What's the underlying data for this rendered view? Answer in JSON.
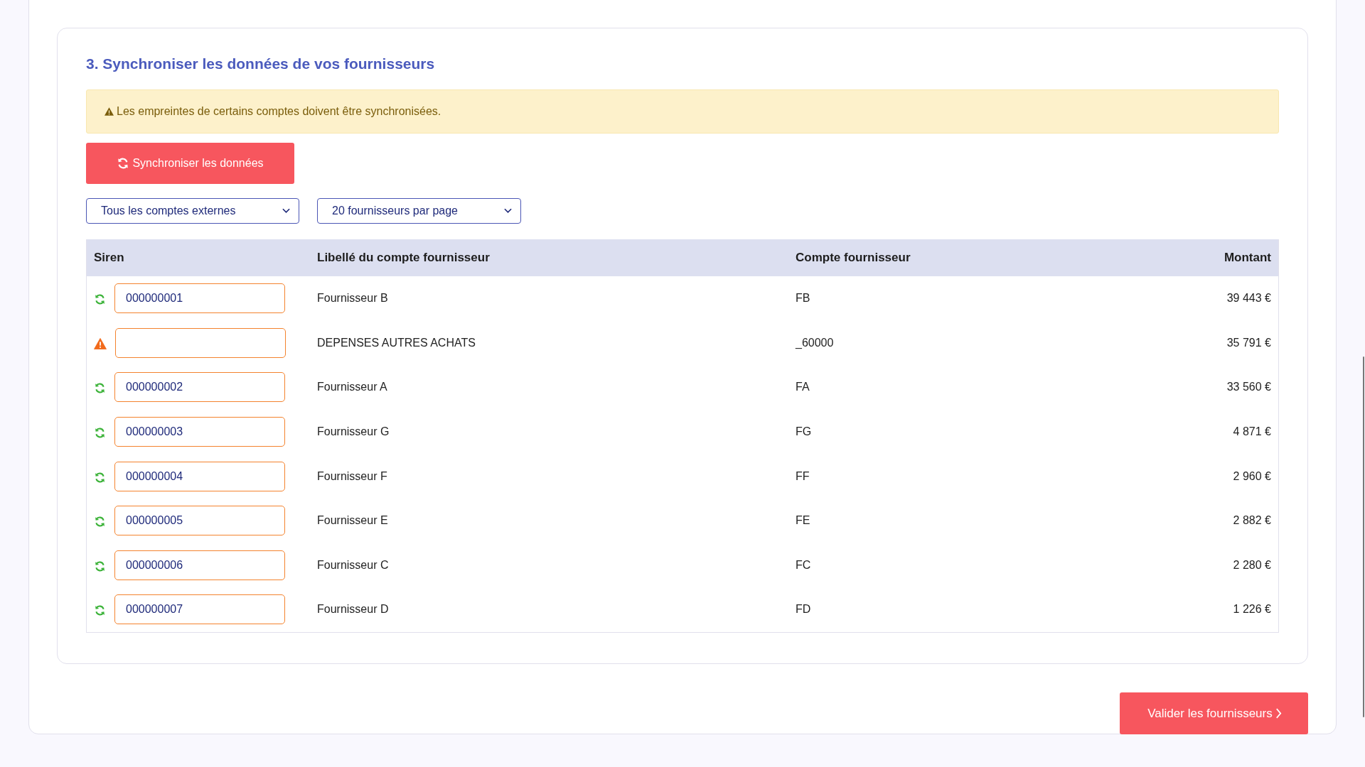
{
  "section": {
    "title": "3. Synchroniser les données de vos fournisseurs"
  },
  "alert": {
    "text": "Les empreintes de certains comptes doivent être synchronisées."
  },
  "sync_button": {
    "label": "Synchroniser les données"
  },
  "filters": [
    {
      "value": "Tous les comptes externes"
    },
    {
      "value": "20 fournisseurs par page"
    }
  ],
  "table": {
    "columns": [
      "Siren",
      "Libellé du compte fournisseur",
      "Compte fournisseur",
      "Montant"
    ],
    "rows": [
      {
        "kind": "synced",
        "siren": "000000001",
        "label": "Fournisseur B",
        "account": "FB",
        "amount": "39 443 €"
      },
      {
        "kind": "warning",
        "label": "DEPENSES AUTRES ACHATS",
        "account": "_60000",
        "amount": "35 791 €"
      },
      {
        "kind": "synced",
        "siren": "000000002",
        "label": "Fournisseur A",
        "account": "FA",
        "amount": "33 560 €"
      },
      {
        "kind": "synced",
        "siren": "000000003",
        "label": "Fournisseur G",
        "account": "FG",
        "amount": "4 871 €"
      },
      {
        "kind": "synced",
        "siren": "000000004",
        "label": "Fournisseur F",
        "account": "FF",
        "amount": "2 960 €"
      },
      {
        "kind": "synced",
        "siren": "000000005",
        "label": "Fournisseur E",
        "account": "FE",
        "amount": "2 882 €"
      },
      {
        "kind": "synced",
        "siren": "000000006",
        "label": "Fournisseur C",
        "account": "FC",
        "amount": "2 280 €"
      },
      {
        "kind": "synced",
        "siren": "000000007",
        "label": "Fournisseur D",
        "account": "FD",
        "amount": "1 226 €"
      }
    ]
  },
  "validate_button": {
    "label": "Valider les fournisseurs"
  }
}
